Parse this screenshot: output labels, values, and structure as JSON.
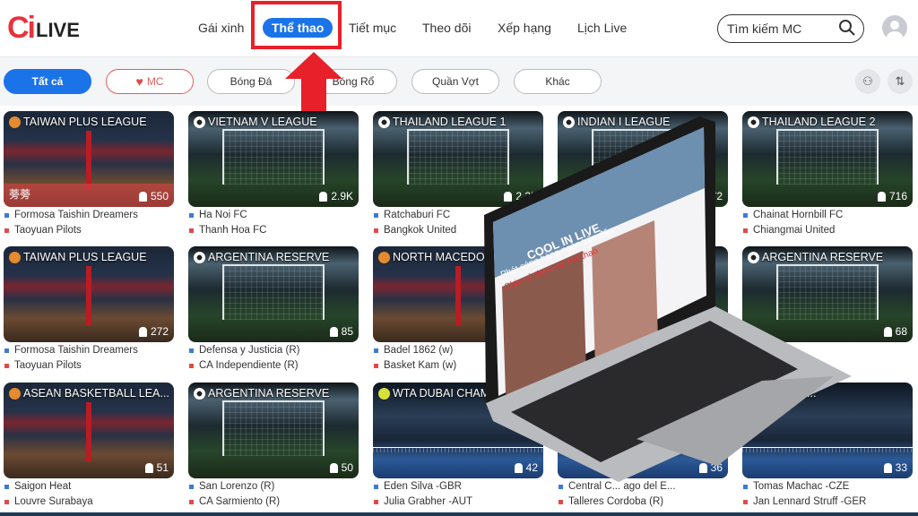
{
  "header": {
    "logo": {
      "mark": "Ci",
      "text": "LIVE"
    },
    "nav": [
      {
        "label": "Gái xinh"
      },
      {
        "label": "Thể thao",
        "active": true
      },
      {
        "label": "Tiết mục"
      },
      {
        "label": "Theo dõi"
      },
      {
        "label": "Xếp hạng"
      },
      {
        "label": "Lịch Live"
      }
    ],
    "search": {
      "placeholder": "Tìm kiếm MC",
      "icon": "search-icon"
    },
    "avatar_icon": "user-avatar-icon"
  },
  "filters": {
    "chips": [
      {
        "label": "Tất cả",
        "active": true
      },
      {
        "label": "MC",
        "icon": "heart-icon"
      },
      {
        "label": "Bóng Đá"
      },
      {
        "label": "Bóng Rổ"
      },
      {
        "label": "Quần Vợt"
      },
      {
        "label": "Khác"
      }
    ],
    "right_icons": [
      "group-icon",
      "sort-icon"
    ]
  },
  "colors": {
    "accent": "#1b73e8",
    "highlight": "#e8202a",
    "home": "#3b7bd4",
    "away": "#e04a4a"
  },
  "cards": [
    {
      "sport": "basket",
      "title": "TAIWAN PLUS LEAGUE",
      "views": "550",
      "mc": "蒡蒡",
      "home": "Formosa Taishin Dreamers",
      "away": "Taoyuan Pilots"
    },
    {
      "sport": "soccer",
      "title": "VIETNAM V LEAGUE",
      "views": "2.9K",
      "home": "Ha Noi FC",
      "away": "Thanh Hoa FC"
    },
    {
      "sport": "soccer",
      "title": "THAILAND LEAGUE 1",
      "views": "2.3K",
      "home": "Ratchaburi FC",
      "away": "Bangkok United"
    },
    {
      "sport": "soccer",
      "title": "INDIAN I LEAGUE",
      "views": "72",
      "home": "",
      "away": ""
    },
    {
      "sport": "soccer",
      "title": "THAILAND LEAGUE 2",
      "views": "716",
      "home": "Chainat Hornbill FC",
      "away": "Chiangmai United"
    },
    {
      "sport": "basket",
      "title": "TAIWAN PLUS LEAGUE",
      "views": "272",
      "home": "Formosa Taishin Dreamers",
      "away": "Taoyuan Pilots"
    },
    {
      "sport": "soccer",
      "title": "ARGENTINA RESERVE",
      "views": "85",
      "home": "Defensa y Justicia (R)",
      "away": "CA Independiente (R)"
    },
    {
      "sport": "basket",
      "title": "NORTH MACEDONIA",
      "views": "",
      "home": "Badel 1862 (w)",
      "away": "Basket Kam (w)"
    },
    {
      "sport": "soccer",
      "title": "",
      "views": "",
      "home": "",
      "away": ""
    },
    {
      "sport": "soccer",
      "title": "ARGENTINA RESERVE",
      "views": "68",
      "home": "",
      "away": "(R)"
    },
    {
      "sport": "basket",
      "title": "ASEAN BASKETBALL LEA...",
      "views": "51",
      "home": "Saigon Heat",
      "away": "Louvre Surabaya"
    },
    {
      "sport": "soccer",
      "title": "ARGENTINA RESERVE",
      "views": "50",
      "home": "San Lorenzo (R)",
      "away": "CA Sarmiento (R)"
    },
    {
      "sport": "tennis",
      "title": "WTA DUBAI CHAMPIONSHIPS",
      "views": "42",
      "home": "Eden Silva -GBR",
      "away": "Julia Grabher -AUT"
    },
    {
      "sport": "tennis",
      "title": "",
      "views": "36",
      "home": "Central C... ago del E...",
      "away": "Talleres Cordoba (R)"
    },
    {
      "sport": "tennis",
      "title": "... MANA...",
      "views": "33",
      "home": "Tomas Machac -CZE",
      "away": "Jan Lennard Struff -GER"
    }
  ],
  "overlay": {
    "laptop_screen_text": [
      "COOL IN LIVE",
      "Phát sóng hàng ngàn trận đấu",
      "Chia sẻ đam mê thể thao"
    ]
  }
}
